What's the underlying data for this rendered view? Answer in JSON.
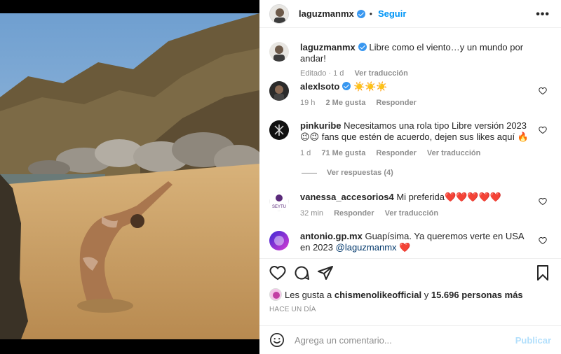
{
  "post": {
    "author": "laguzmanmx",
    "follow_label": "Seguir",
    "more_label": "•••",
    "caption": "Libre como el viento…y un mundo por andar!",
    "caption_meta": "Editado · 1 d",
    "see_translation": "Ver traducción"
  },
  "comments": [
    {
      "user": "alexlsoto",
      "text": "☀️☀️☀️",
      "time": "19 h",
      "likes": "2 Me gusta",
      "reply": "Responder"
    },
    {
      "user": "pinkuribe",
      "text": "Necesitamos una rola tipo Libre versión 2023 😉😉 fans que estén de acuerdo, dejen sus likes aquí 🔥",
      "time": "1 d",
      "likes": "71 Me gusta",
      "reply": "Responder",
      "translate": "Ver traducción",
      "view_replies": "Ver respuestas (4)"
    },
    {
      "user": "vanessa_accesorios4",
      "text": "Mi preferida❤️❤️❤️❤️❤️",
      "time": "32 min",
      "reply": "Responder",
      "translate": "Ver traducción",
      "avatar_text": "SEYTU"
    },
    {
      "user": "antonio.gp.mx",
      "text": "Guapísima. Ya queremos verte en USA en 2023",
      "mention": "@laguzmanmx",
      "emoji": "❤️"
    }
  ],
  "likes": {
    "prefix": "Les gusta a",
    "user": "chismenolikeofficial",
    "middle": "y",
    "count": "15.696 personas más"
  },
  "timestamp": "HACE UN DÍA",
  "composer": {
    "placeholder": "Agrega un comentario...",
    "post_label": "Publicar"
  },
  "colors": {
    "accent": "#0095f6",
    "verified": "#3897f0",
    "muted": "#8e8e8e"
  }
}
